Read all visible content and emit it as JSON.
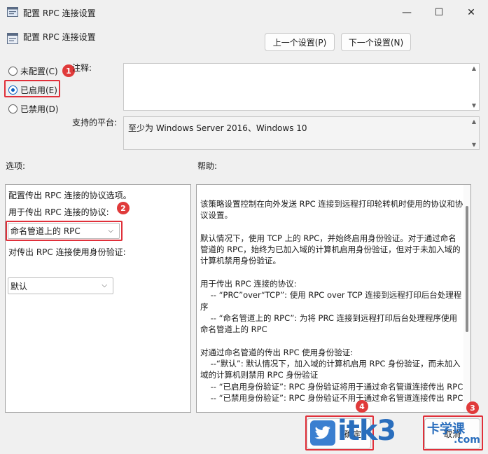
{
  "window": {
    "title": "配置 RPC 连接设置",
    "minimize_glyph": "—",
    "maximize_glyph": "☐",
    "close_glyph": "✕"
  },
  "header": {
    "title": "配置 RPC 连接设置",
    "prev_button": "上一个设置(P)",
    "next_button": "下一个设置(N)"
  },
  "state_options": [
    {
      "label": "未配置(C)",
      "selected": false
    },
    {
      "label": "已启用(E)",
      "selected": true
    },
    {
      "label": "已禁用(D)",
      "selected": false
    }
  ],
  "comment": {
    "label": "注释:",
    "value": ""
  },
  "platform": {
    "label": "支持的平台:",
    "value": "至少为 Windows Server 2016、Windows 10"
  },
  "options_panel": {
    "heading": "选项:",
    "description": "配置传出 RPC 连接的协议选项。",
    "protocol_label": "用于传出 RPC 连接的协议:",
    "protocol_value": "命名管道上的 RPC",
    "auth_label": "对传出 RPC 连接使用身份验证:",
    "auth_value": "默认"
  },
  "help_panel": {
    "heading": "帮助:",
    "text": "该策略设置控制在向外发送 RPC 连接到远程打印轮转机时使用的协议和协议设置。\n\n默认情况下，使用 TCP 上的 RPC，并始终启用身份验证。对于通过命名管道的 RPC，始终为已加入域的计算机启用身份验证，但对于未加入域的计算机禁用身份验证。\n\n用于传出 RPC 连接的协议:\n    -- “PRC”over“TCP”: 使用 RPC over TCP 连接到远程打印后台处理程序\n    -- “命名管道上的 RPC”: 为将 PRC 连接到远程打印后台处理程序使用命名管道上的 RPC\n\n对通过命名管道的传出 RPC 使用身份验证:\n    --“默认”: 默认情况下，加入域的计算机启用 RPC 身份验证，而未加入域的计算机则禁用 RPC 身份验证\n    -- “已启用身份验证”: RPC 身份验证将用于通过命名管道连接传出 RPC\n    -- “已禁用身份验证”: RPC 身份验证不用于通过命名管道连接传出 RPC"
  },
  "footer": {
    "ok_button": "确定",
    "cancel_button": "取消"
  },
  "annotations": [
    {
      "number": "1"
    },
    {
      "number": "2"
    },
    {
      "number": "3"
    },
    {
      "number": "4"
    }
  ],
  "watermark": {
    "text": "itk3",
    "suffix": ".com",
    "sub": "卡学课"
  },
  "colors": {
    "accent": "#0a5fbf",
    "highlight": "#e0303a",
    "watermark_blue": "#2a6ebd"
  }
}
